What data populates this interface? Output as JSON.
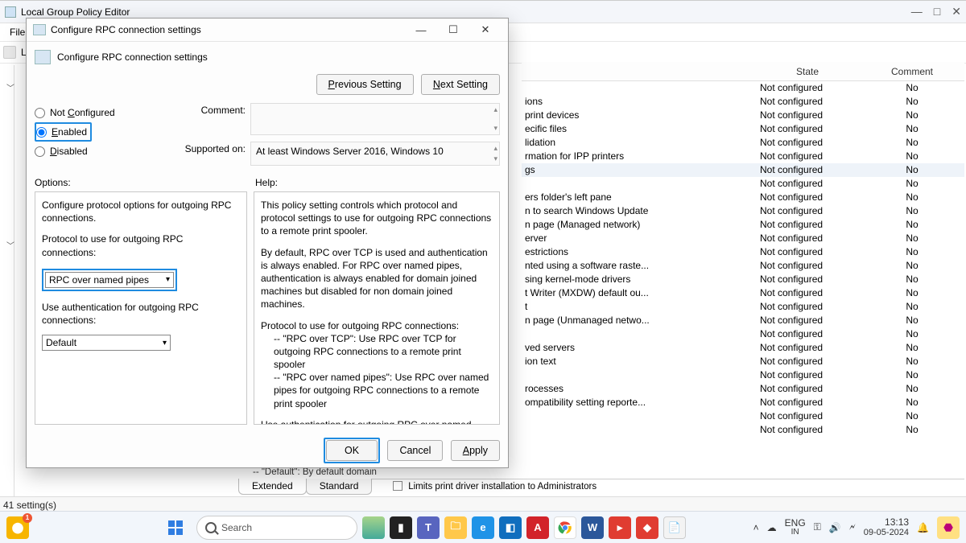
{
  "main": {
    "title": "Local Group Policy Editor",
    "menu": {
      "file": "File"
    },
    "status": "41 setting(s)",
    "tabs": {
      "extended": "Extended",
      "standard": "Standard"
    },
    "preview_icon_text": "Limits print driver installation to Administrators",
    "preview_extra": "-- \"Default\": By default domain",
    "columns": {
      "state": "State",
      "comment": "Comment"
    },
    "rows": [
      {
        "name": "",
        "state": "Not configured",
        "comment": "No"
      },
      {
        "name": "ions",
        "state": "Not configured",
        "comment": "No"
      },
      {
        "name": "print devices",
        "state": "Not configured",
        "comment": "No"
      },
      {
        "name": "ecific files",
        "state": "Not configured",
        "comment": "No"
      },
      {
        "name": "lidation",
        "state": "Not configured",
        "comment": "No"
      },
      {
        "name": "rmation for IPP printers",
        "state": "Not configured",
        "comment": "No"
      },
      {
        "name": "gs",
        "state": "Not configured",
        "comment": "No",
        "hl": true
      },
      {
        "name": "",
        "state": "Not configured",
        "comment": "No"
      },
      {
        "name": "ers folder's left pane",
        "state": "Not configured",
        "comment": "No"
      },
      {
        "name": "n to search Windows Update",
        "state": "Not configured",
        "comment": "No"
      },
      {
        "name": "n page (Managed network)",
        "state": "Not configured",
        "comment": "No"
      },
      {
        "name": "erver",
        "state": "Not configured",
        "comment": "No"
      },
      {
        "name": "estrictions",
        "state": "Not configured",
        "comment": "No"
      },
      {
        "name": "nted using a software raste...",
        "state": "Not configured",
        "comment": "No"
      },
      {
        "name": "sing kernel-mode drivers",
        "state": "Not configured",
        "comment": "No"
      },
      {
        "name": "t Writer (MXDW) default ou...",
        "state": "Not configured",
        "comment": "No"
      },
      {
        "name": "t",
        "state": "Not configured",
        "comment": "No"
      },
      {
        "name": "n page (Unmanaged netwo...",
        "state": "Not configured",
        "comment": "No"
      },
      {
        "name": "",
        "state": "Not configured",
        "comment": "No"
      },
      {
        "name": "ved servers",
        "state": "Not configured",
        "comment": "No"
      },
      {
        "name": "ion text",
        "state": "Not configured",
        "comment": "No"
      },
      {
        "name": "",
        "state": "Not configured",
        "comment": "No"
      },
      {
        "name": "rocesses",
        "state": "Not configured",
        "comment": "No"
      },
      {
        "name": "ompatibility setting reporte...",
        "state": "Not configured",
        "comment": "No"
      },
      {
        "name": "",
        "state": "Not configured",
        "comment": "No"
      },
      {
        "name": "",
        "state": "Not configured",
        "comment": "No"
      }
    ]
  },
  "dialog": {
    "title": "Configure RPC connection settings",
    "header": "Configure RPC connection settings",
    "prev": "Previous Setting",
    "next": "Next Setting",
    "notconf": "Not Configured",
    "enabled": "Enabled",
    "disabled": "Disabled",
    "comment_lab": "Comment:",
    "supported_lab": "Supported on:",
    "supported_val": "At least Windows Server 2016, Windows 10",
    "options_lab": "Options:",
    "help_lab": "Help:",
    "opt_intro": "Configure protocol options for outgoing RPC connections.",
    "proto_lab": "Protocol to use for outgoing RPC connections:",
    "proto_val": "RPC over named pipes",
    "auth_lab": "Use authentication for outgoing RPC connections:",
    "auth_val": "Default",
    "help_p1": "This policy setting controls which protocol and protocol settings to use for outgoing RPC connections to a remote print spooler.",
    "help_p2": "By default, RPC over TCP is used and authentication is always enabled. For RPC over named pipes, authentication is always enabled for domain joined machines but disabled for non domain joined machines.",
    "help_p3": "Protocol to use for outgoing RPC connections:",
    "help_p3a": "-- \"RPC over TCP\": Use RPC over TCP for outgoing RPC connections to a remote print spooler",
    "help_p3b": "-- \"RPC over named pipes\": Use RPC over named pipes for outgoing RPC connections to a remote print spooler",
    "help_p4": "Use authentication for outgoing RPC over named pipes connections:",
    "help_p4a": "-- \"Default\": By default domain joined computers enable RPC authentication for RPC over named pipes while non domain joined computers disable RPC authentication for RPC over named pipes",
    "ok": "OK",
    "cancel": "Cancel",
    "apply": "Apply"
  },
  "taskbar": {
    "search_placeholder": "Search",
    "lang1": "ENG",
    "lang2": "IN",
    "time": "13:13",
    "date": "09-05-2024"
  }
}
